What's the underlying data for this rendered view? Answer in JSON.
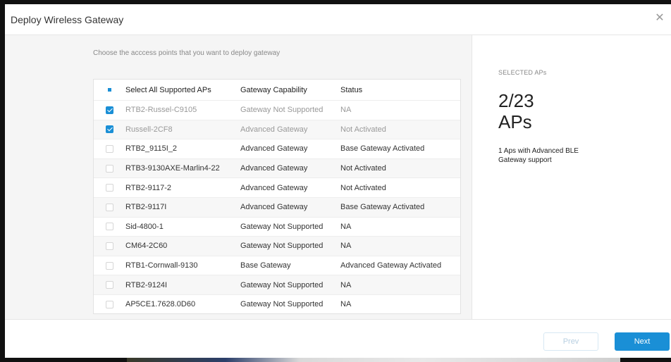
{
  "modal": {
    "title": "Deploy Wireless Gateway",
    "close_icon": "✕"
  },
  "instruction": "Choose the acccess points that you want to deploy gateway",
  "table": {
    "headers": [
      "Select All Supported APs",
      "Gateway Capability",
      "Status"
    ],
    "rows": [
      {
        "name": "RTB2-Russel-C9105",
        "capability": "Gateway Not Supported",
        "status": "NA",
        "checked": true,
        "disabled": true
      },
      {
        "name": "Russell-2CF8",
        "capability": "Advanced Gateway",
        "status": "Not Activated",
        "checked": true,
        "disabled": true
      },
      {
        "name": "RTB2_9115I_2",
        "capability": "Advanced Gateway",
        "status": "Base Gateway Activated",
        "checked": false,
        "disabled": false
      },
      {
        "name": "RTB3-9130AXE-Marlin4-22",
        "capability": "Advanced Gateway",
        "status": "Not Activated",
        "checked": false,
        "disabled": false
      },
      {
        "name": "RTB2-9117-2",
        "capability": "Advanced Gateway",
        "status": "Not Activated",
        "checked": false,
        "disabled": false
      },
      {
        "name": "RTB2-9117I",
        "capability": "Advanced Gateway",
        "status": "Base Gateway Activated",
        "checked": false,
        "disabled": false
      },
      {
        "name": "Sid-4800-1",
        "capability": "Gateway Not Supported",
        "status": "NA",
        "checked": false,
        "disabled": false
      },
      {
        "name": "CM64-2C60",
        "capability": "Gateway Not Supported",
        "status": "NA",
        "checked": false,
        "disabled": false
      },
      {
        "name": "RTB1-Cornwall-9130",
        "capability": "Base Gateway",
        "status": "Advanced Gateway Activated",
        "checked": false,
        "disabled": false
      },
      {
        "name": "RTB2-9124I",
        "capability": "Gateway Not Supported",
        "status": "NA",
        "checked": false,
        "disabled": false
      },
      {
        "name": "AP5CE1.7628.0D60",
        "capability": "Gateway Not Supported",
        "status": "NA",
        "checked": false,
        "disabled": false
      }
    ]
  },
  "summary": {
    "label": "SELECTED APs",
    "count": "2/23",
    "unit": "APs",
    "note": "1 Aps with Advanced BLE Gateway support"
  },
  "footer": {
    "prev_label": "Prev",
    "next_label": "Next"
  },
  "colors": {
    "accent": "#1a8fd6"
  }
}
